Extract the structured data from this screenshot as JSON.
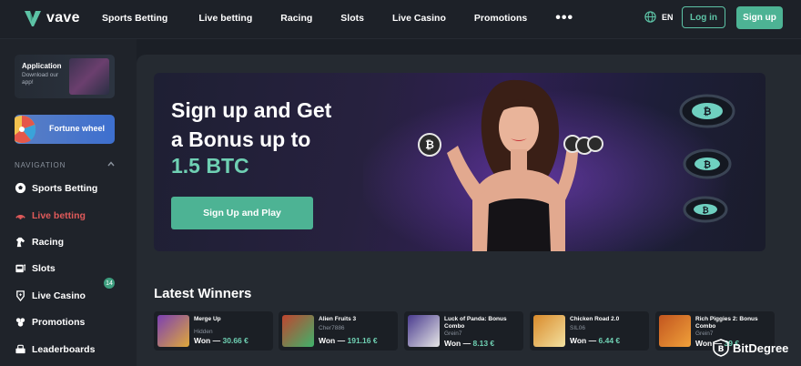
{
  "header": {
    "logo_text": "vave",
    "nav": [
      "Sports Betting",
      "Live betting",
      "Racing",
      "Slots",
      "Live Casino",
      "Promotions"
    ],
    "more": "•••",
    "lang": "EN",
    "login_label": "Log in",
    "signup_label": "Sign up"
  },
  "sidebar": {
    "app_title": "Application",
    "app_sub": "Download our app!",
    "fortune_label": "Fortune wheel",
    "nav_heading": "NAVIGATION",
    "items": [
      {
        "label": "Sports Betting",
        "icon": "soccer-ball-icon"
      },
      {
        "label": "Live betting",
        "icon": "live-signal-icon"
      },
      {
        "label": "Racing",
        "icon": "horse-icon"
      },
      {
        "label": "Slots",
        "icon": "slot-machine-icon"
      },
      {
        "label": "Live Casino",
        "icon": "casino-chip-icon"
      },
      {
        "label": "Promotions",
        "icon": "gift-icon"
      },
      {
        "label": "Leaderboards",
        "icon": "leaderboard-icon"
      }
    ],
    "promotions_badge": "14"
  },
  "banner": {
    "line1": "Sign up and Get",
    "line2": "a Bonus up to",
    "line3": "1.5 BTC",
    "cta": "Sign Up and Play"
  },
  "winners": {
    "title": "Latest Winners",
    "won_label": "Won —",
    "items": [
      {
        "game": "Merge Up",
        "user": "Hidden",
        "amount": "30.66 €",
        "color": "#7b3fb3"
      },
      {
        "game": "Alien Fruits 3",
        "user": "Cher7886",
        "amount": "191.16 €",
        "color": "#c0452f"
      },
      {
        "game": "Luck of Panda: Bonus Combo",
        "user": "Grein7",
        "amount": "8.13 €",
        "color": "#4a3b8f"
      },
      {
        "game": "Chicken Road 2.0",
        "user": "SIL06",
        "amount": "6.44 €",
        "color": "#d98a2b"
      },
      {
        "game": "Rich Piggies 2: Bonus Combo",
        "user": "Grein7",
        "amount": "39 €",
        "color": "#c2551f"
      }
    ]
  },
  "watermark": "BitDegree",
  "colors": {
    "accent": "#4db394",
    "active": "#e05a5a",
    "highlight": "#6fd0b3"
  }
}
